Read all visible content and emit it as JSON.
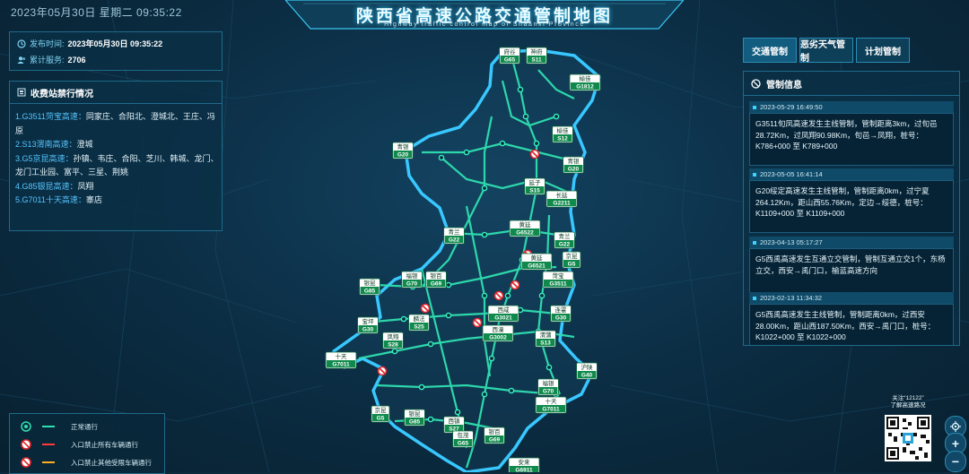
{
  "header": {
    "datetime": "2023年05月30日 星期二  09:35:22",
    "title": "陕西省高速公路交通管制地图",
    "subtitle": "Highway traffic control map of Shaanxi Province"
  },
  "info": {
    "publish_label": "发布时间:",
    "publish_value": "2023年05月30日  09:35:22",
    "visits_label": "累计服务:",
    "visits_value": "2706"
  },
  "toll": {
    "title": "收费站禁行情况",
    "items": [
      {
        "road": "1.G3511菏宝高速：",
        "stations": "同家庄、合阳北、澄城北、王庄、冯原"
      },
      {
        "road": "2.S13渭南高速：",
        "stations": "澄城"
      },
      {
        "road": "3.G5京昆高速：",
        "stations": "孙镇、韦庄、合阳、芝川、韩城、龙门、龙门工业园、富平、三星、荆姚"
      },
      {
        "road": "4.G85银昆高速：",
        "stations": "凤翔"
      },
      {
        "road": "5.G7011十天高速：",
        "stations": "寨店"
      }
    ]
  },
  "tabs": [
    "交通管制",
    "恶劣天气管制",
    "计划管制"
  ],
  "control": {
    "title": "管制信息",
    "events": [
      {
        "date": "2023-05-29 16:49:50",
        "text": "G3511旬凤高速发生主线管制，管制距离3km，过旬邑28.72Km，过凤翔90.98Km，旬邑→凤翔，桩号：K786+000 至 K789+000"
      },
      {
        "date": "2023-05-05 16:41:14",
        "text": "G20绥定高速发生主线管制，管制距离0km，过宁夏264.12Km，距山西55.76Km，定边→绥德，桩号：K1109+000 至 K1109+000"
      },
      {
        "date": "2023-04-13 05:17:27",
        "text": "G5西禹高速发生互通立交管制，管制互通立交1个，东杨立交，西安→禹门口，榆蓝高速方向"
      },
      {
        "date": "2023-02-13 11:34:32",
        "text": "G5西禹高速发生主线管制，管制距离0km，过西安28.00Km，距山西187.50Km，西安→禹门口，桩号：K1022+000 至 K1022+000"
      }
    ]
  },
  "legend": {
    "items": [
      {
        "label": "正常通行",
        "icon": "normal-node-icon",
        "color": "#2fe0b0"
      },
      {
        "label": "入口禁止所有车辆通行",
        "icon": "no-entry-icon",
        "color": "#ff3b3b"
      },
      {
        "label": "入口禁止其他受限车辆通行",
        "icon": "restricted-entry-icon",
        "color": "#ffb020"
      }
    ]
  },
  "qr": {
    "line1": "关注“12122”",
    "line2": "了解高速路况"
  },
  "zoom": {
    "locate": "locate-icon",
    "in": "+",
    "out": "−"
  },
  "highway_labels": [
    {
      "name": "府谷",
      "code": "G65"
    },
    {
      "name": "神府",
      "code": "S11"
    },
    {
      "name": "榆佳",
      "code": "G1812"
    },
    {
      "name": "青银",
      "code": "G20"
    },
    {
      "name": "榆佳",
      "code": "S12"
    },
    {
      "name": "青银",
      "code": "G20"
    },
    {
      "name": "延子",
      "code": "S15"
    },
    {
      "name": "长延",
      "code": "G2211"
    },
    {
      "name": "黄延",
      "code": "G6522"
    },
    {
      "name": "青兰",
      "code": "G22"
    },
    {
      "name": "青兰",
      "code": "G22"
    },
    {
      "name": "银昆",
      "code": "G85"
    },
    {
      "name": "福银",
      "code": "G70"
    },
    {
      "name": "银百",
      "code": "G69"
    },
    {
      "name": "黄延",
      "code": "G6521"
    },
    {
      "name": "京昆",
      "code": "G5"
    },
    {
      "name": "菏宝",
      "code": "G3511"
    },
    {
      "name": "宝坪",
      "code": "G30"
    },
    {
      "name": "麟法",
      "code": "S25"
    },
    {
      "name": "凤翔",
      "code": "S28"
    },
    {
      "name": "西咸",
      "code": "G3021"
    },
    {
      "name": "西潼",
      "code": "G3002"
    },
    {
      "name": "连霍",
      "code": "G30"
    },
    {
      "name": "渭蒲",
      "code": "S13"
    },
    {
      "name": "十天",
      "code": "G7011"
    },
    {
      "name": "沪陕",
      "code": "G40"
    },
    {
      "name": "福银",
      "code": "G70"
    },
    {
      "name": "十天",
      "code": "G7011"
    },
    {
      "name": "京昆",
      "code": "G5"
    },
    {
      "name": "银昆",
      "code": "G85"
    },
    {
      "name": "西镇",
      "code": "S27"
    },
    {
      "name": "包茂",
      "code": "G65"
    },
    {
      "name": "银百",
      "code": "G69"
    },
    {
      "name": "安来",
      "code": "G6911"
    }
  ]
}
